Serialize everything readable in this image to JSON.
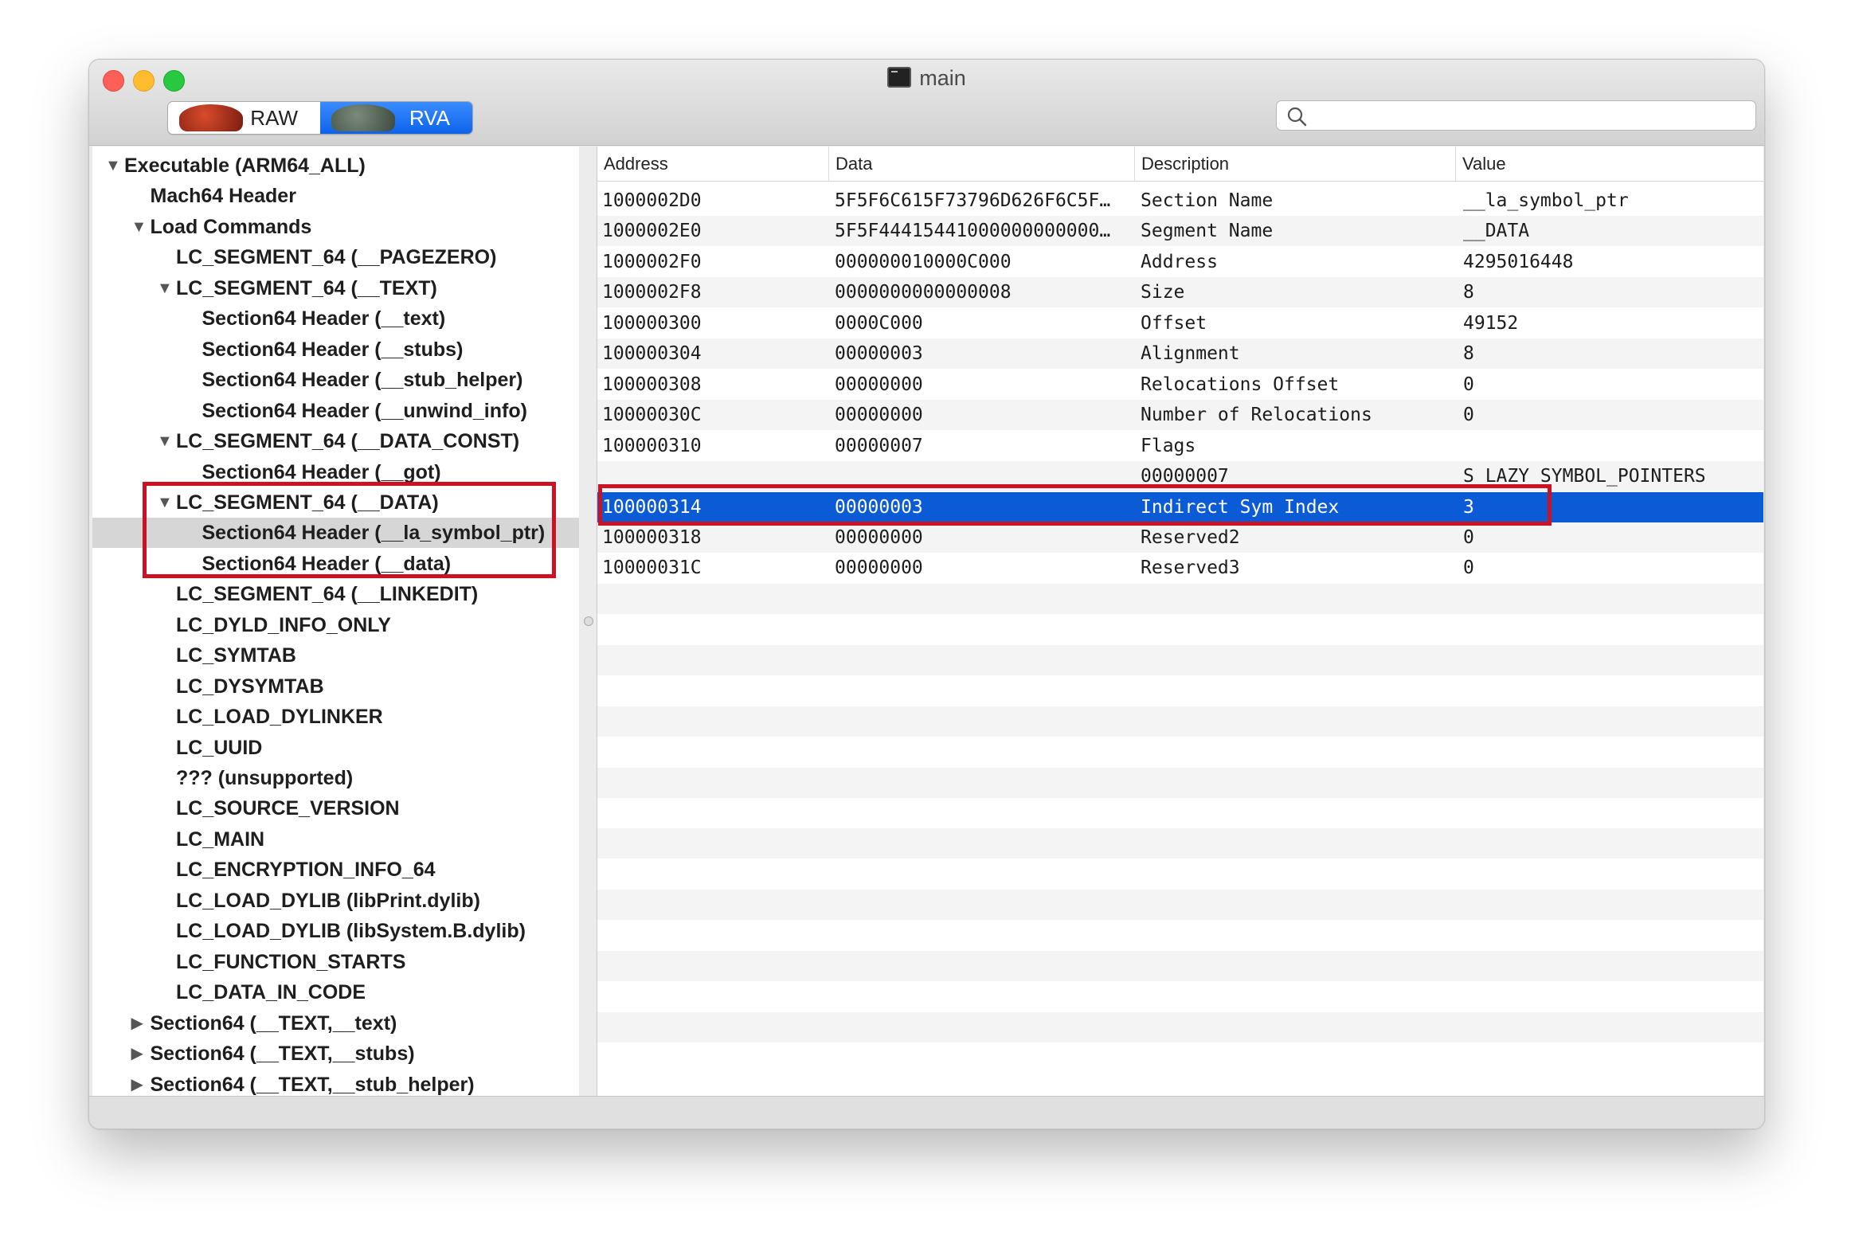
{
  "window": {
    "title": "main"
  },
  "toolbar": {
    "raw_label": "RAW",
    "rva_label": "RVA",
    "search_placeholder": ""
  },
  "tree": [
    {
      "label": "Executable  (ARM64_ALL)",
      "level": 0,
      "disclosure": "open"
    },
    {
      "label": "Mach64 Header",
      "level": 1,
      "disclosure": "none"
    },
    {
      "label": "Load Commands",
      "level": 1,
      "disclosure": "open"
    },
    {
      "label": "LC_SEGMENT_64 (__PAGEZERO)",
      "level": 2,
      "disclosure": "none"
    },
    {
      "label": "LC_SEGMENT_64 (__TEXT)",
      "level": 2,
      "disclosure": "open"
    },
    {
      "label": "Section64 Header (__text)",
      "level": 3,
      "disclosure": "none"
    },
    {
      "label": "Section64 Header (__stubs)",
      "level": 3,
      "disclosure": "none"
    },
    {
      "label": "Section64 Header (__stub_helper)",
      "level": 3,
      "disclosure": "none"
    },
    {
      "label": "Section64 Header (__unwind_info)",
      "level": 3,
      "disclosure": "none"
    },
    {
      "label": "LC_SEGMENT_64 (__DATA_CONST)",
      "level": 2,
      "disclosure": "open"
    },
    {
      "label": "Section64 Header (__got)",
      "level": 3,
      "disclosure": "none"
    },
    {
      "label": "LC_SEGMENT_64 (__DATA)",
      "level": 2,
      "disclosure": "open"
    },
    {
      "label": "Section64 Header (__la_symbol_ptr)",
      "level": 3,
      "disclosure": "none",
      "selected": true
    },
    {
      "label": "Section64 Header (__data)",
      "level": 3,
      "disclosure": "none"
    },
    {
      "label": "LC_SEGMENT_64 (__LINKEDIT)",
      "level": 2,
      "disclosure": "none"
    },
    {
      "label": "LC_DYLD_INFO_ONLY",
      "level": 2,
      "disclosure": "none"
    },
    {
      "label": "LC_SYMTAB",
      "level": 2,
      "disclosure": "none"
    },
    {
      "label": "LC_DYSYMTAB",
      "level": 2,
      "disclosure": "none"
    },
    {
      "label": "LC_LOAD_DYLINKER",
      "level": 2,
      "disclosure": "none"
    },
    {
      "label": "LC_UUID",
      "level": 2,
      "disclosure": "none"
    },
    {
      "label": "??? (unsupported)",
      "level": 2,
      "disclosure": "none"
    },
    {
      "label": "LC_SOURCE_VERSION",
      "level": 2,
      "disclosure": "none"
    },
    {
      "label": "LC_MAIN",
      "level": 2,
      "disclosure": "none"
    },
    {
      "label": "LC_ENCRYPTION_INFO_64",
      "level": 2,
      "disclosure": "none"
    },
    {
      "label": "LC_LOAD_DYLIB (libPrint.dylib)",
      "level": 2,
      "disclosure": "none"
    },
    {
      "label": "LC_LOAD_DYLIB (libSystem.B.dylib)",
      "level": 2,
      "disclosure": "none"
    },
    {
      "label": "LC_FUNCTION_STARTS",
      "level": 2,
      "disclosure": "none"
    },
    {
      "label": "LC_DATA_IN_CODE",
      "level": 2,
      "disclosure": "none"
    },
    {
      "label": "Section64 (__TEXT,__text)",
      "level": 1,
      "disclosure": "closed"
    },
    {
      "label": "Section64 (__TEXT,__stubs)",
      "level": 1,
      "disclosure": "closed"
    },
    {
      "label": "Section64 (__TEXT,__stub_helper)",
      "level": 1,
      "disclosure": "closed"
    }
  ],
  "table": {
    "headers": [
      "Address",
      "Data",
      "Description",
      "Value"
    ],
    "rows": [
      [
        "1000002D0",
        "5F5F6C615F73796D626F6C5F…",
        "Section Name",
        "__la_symbol_ptr"
      ],
      [
        "1000002E0",
        "5F5F44415441000000000000…",
        "Segment Name",
        "__DATA"
      ],
      [
        "1000002F0",
        "000000010000C000",
        "Address",
        "4295016448"
      ],
      [
        "1000002F8",
        "0000000000000008",
        "Size",
        "8"
      ],
      [
        "100000300",
        "0000C000",
        "Offset",
        "49152"
      ],
      [
        "100000304",
        "00000003",
        "Alignment",
        "8"
      ],
      [
        "100000308",
        "00000000",
        "Relocations Offset",
        "0"
      ],
      [
        "10000030C",
        "00000000",
        "Number of Relocations",
        "0"
      ],
      [
        "100000310",
        "00000007",
        "Flags",
        ""
      ],
      [
        "",
        "",
        "00000007",
        "S_LAZY_SYMBOL_POINTERS"
      ],
      [
        "100000314",
        "00000003",
        "Indirect Sym Index",
        "3"
      ],
      [
        "100000318",
        "00000000",
        "Reserved2",
        "0"
      ],
      [
        "10000031C",
        "00000000",
        "Reserved3",
        "0"
      ]
    ],
    "selected_row": 10,
    "empty_rows": 16
  },
  "colors": {
    "selection": "#0b5bd7",
    "annotation": "#cc1122",
    "sidebar_selection": "#d6d6d6"
  }
}
